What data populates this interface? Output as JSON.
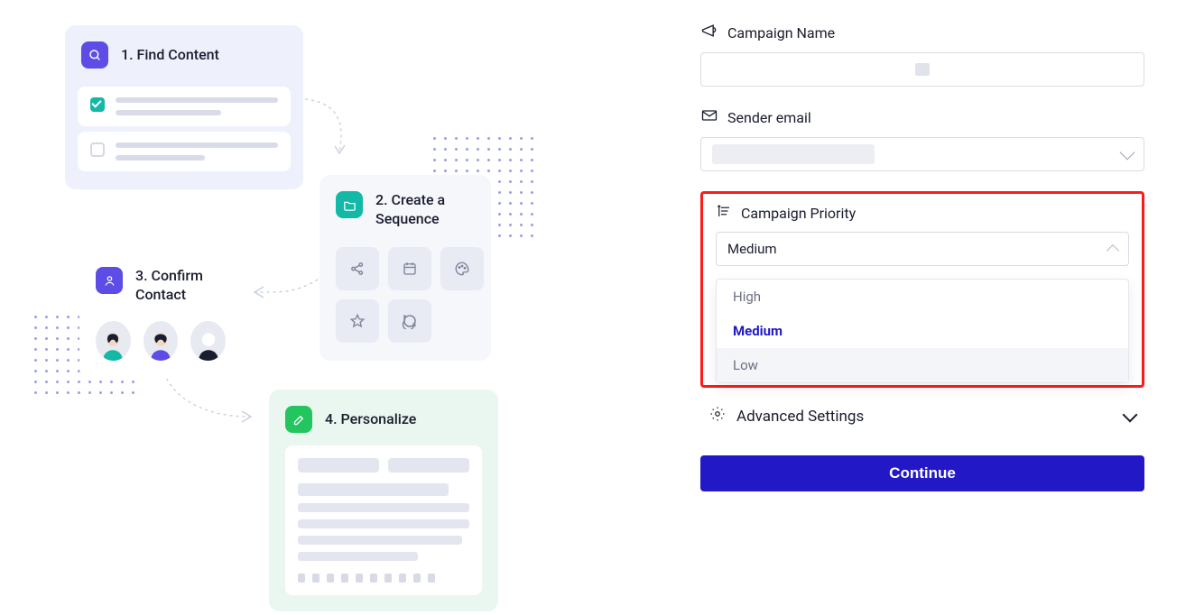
{
  "steps": {
    "find": {
      "label": "1. Find Content"
    },
    "seq": {
      "label": "2.",
      "title": "Create a Sequence"
    },
    "contact": {
      "label": "3.",
      "title": "Confirm Contact"
    },
    "pers": {
      "label": "4. Personalize"
    }
  },
  "form": {
    "campaign_name": {
      "label": "Campaign Name"
    },
    "sender_email": {
      "label": "Sender email"
    },
    "priority": {
      "label": "Campaign Priority",
      "selected": "Medium",
      "options": {
        "high": "High",
        "medium": "Medium",
        "low": "Low"
      }
    },
    "advanced": {
      "label": "Advanced Settings"
    },
    "continue": "Continue"
  }
}
